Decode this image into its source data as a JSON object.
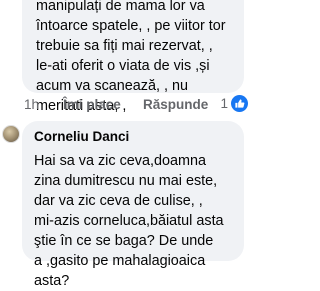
{
  "comment_previous": {
    "text": "manipulați de mama lor  va\nîntoarce spatele, , pe viitor tor\ntrebuie sa fiți mai rezervat, ,\nle-ati oferit o viata de vis ,și\nacum va scanează, , nu\nmeritati asta, ,"
  },
  "comment_actions": {
    "time": "1h",
    "like_label": "Îmi place",
    "reply_label": "Răspunde",
    "reaction_count": "1"
  },
  "comment_current": {
    "author": "Corneliu Danci",
    "text": "Hai sa va zic ceva,doamna\nzina dumitrescu nu mai este,\ndar va zic ceva de culise, ,\nmi-azis corneluca,băiatul asta\nştie în ce se baga? De unde\na ,gasito pe mahalagioaica\nasta?"
  },
  "colors": {
    "bubble": "#f0f2f5",
    "meta": "#65676b",
    "like_blue": "#1877f2"
  },
  "icons": {
    "reaction": "thumbs-up-icon",
    "avatar": "profile-avatar"
  }
}
